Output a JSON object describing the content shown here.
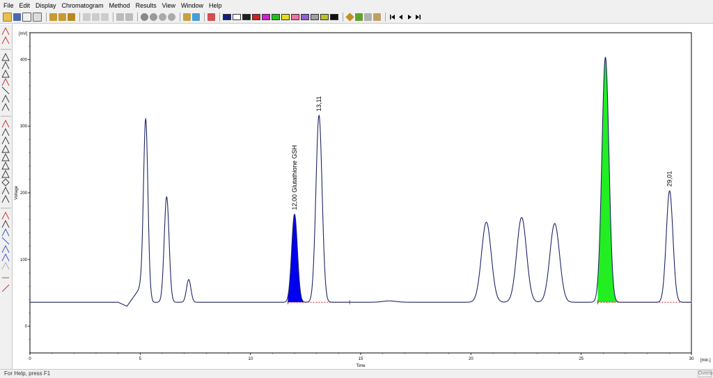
{
  "menu": [
    "File",
    "Edit",
    "Display",
    "Chromatogram",
    "Method",
    "Results",
    "View",
    "Window",
    "Help"
  ],
  "status_bar": {
    "text": "For Help, press F1",
    "panel": "Overlay"
  },
  "colors": {
    "trace": "#1c2466",
    "glutathione_peak_fill": "#0000ee",
    "green_peak_fill": "#22ee22",
    "baseline": "#cc0000",
    "axis": "#000000"
  },
  "chart_data": {
    "type": "line",
    "xlabel": "Time",
    "ylabel": "Voltage",
    "x_unit": "[min.]",
    "y_unit": "[mV]",
    "xlim": [
      0,
      30
    ],
    "ylim": [
      -40,
      440
    ],
    "xticks": [
      0,
      5,
      10,
      15,
      20,
      25,
      30
    ],
    "yticks": [
      0,
      100,
      200,
      300,
      400
    ],
    "baseline_level": 36,
    "series": [
      {
        "values_description": "detector trace",
        "start": {
          "x": 0.0,
          "y": 36
        },
        "dip": {
          "x": 4.4,
          "y": 30
        },
        "rise_to": {
          "x": 5.0,
          "y": 58
        },
        "peaks": [
          {
            "rt": 5.25,
            "height": 298,
            "width": 0.1,
            "label": ""
          },
          {
            "rt": 6.2,
            "height": 194,
            "width": 0.11,
            "label": ""
          },
          {
            "rt": 7.2,
            "height": 70,
            "width": 0.1,
            "label": ""
          },
          {
            "rt": 12.0,
            "height": 168,
            "width": 0.13,
            "label": "12,00 Glutathione GSH"
          },
          {
            "rt": 13.11,
            "height": 316,
            "width": 0.14,
            "label": "13,11"
          },
          {
            "rt": 20.7,
            "height": 156,
            "width": 0.22,
            "label": ""
          },
          {
            "rt": 22.3,
            "height": 163,
            "width": 0.22,
            "label": ""
          },
          {
            "rt": 23.8,
            "height": 154,
            "width": 0.22,
            "label": ""
          },
          {
            "rt": 26.1,
            "height": 403,
            "width": 0.16,
            "label": ""
          },
          {
            "rt": 29.01,
            "height": 203,
            "width": 0.15,
            "label": "29,01"
          }
        ]
      }
    ],
    "filled_peaks": [
      {
        "rt": 12.0,
        "from": 11.7,
        "to": 12.45,
        "color": "blue"
      },
      {
        "rt": 26.1,
        "from": 25.75,
        "to": 26.75,
        "color": "green"
      }
    ],
    "integration_baselines": [
      {
        "from": 11.7,
        "to": 14.5
      },
      {
        "from": 25.75,
        "to": 30.0
      }
    ]
  }
}
